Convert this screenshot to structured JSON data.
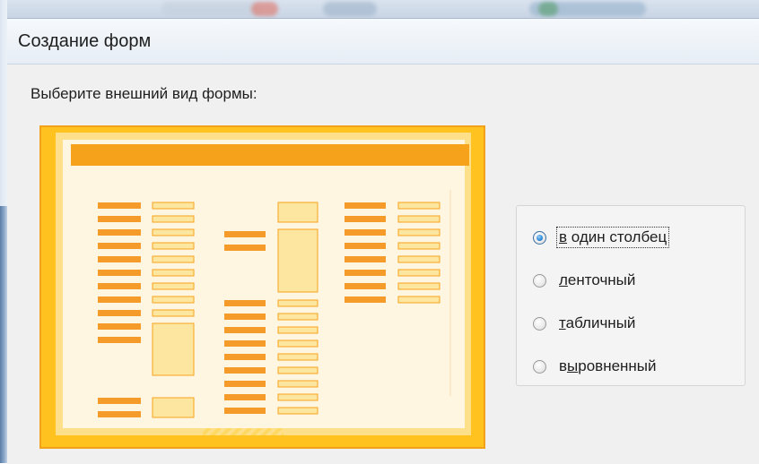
{
  "dialog": {
    "title": "Создание форм",
    "prompt": "Выберите внешний вид формы:"
  },
  "layout_options": {
    "selected": "в один столбец",
    "items": [
      {
        "label": "в один столбец",
        "accel": "в",
        "rest": " один столбец",
        "checked": true
      },
      {
        "label": "ленточный",
        "accel": "л",
        "rest": "енточный",
        "checked": false
      },
      {
        "label": "табличный",
        "accel": "т",
        "rest": "абличный",
        "checked": false
      },
      {
        "label": "выровненный",
        "accel": "ы",
        "pre": "в",
        "rest": "ровненный",
        "checked": false
      }
    ]
  },
  "colors": {
    "preview_frame": "#ffc21f",
    "preview_border": "#f2a11a",
    "preview_paper": "#fff6e2",
    "preview_header": "#f7a21b",
    "label_block": "#f59b2a",
    "field_block": "#fde7a0"
  }
}
